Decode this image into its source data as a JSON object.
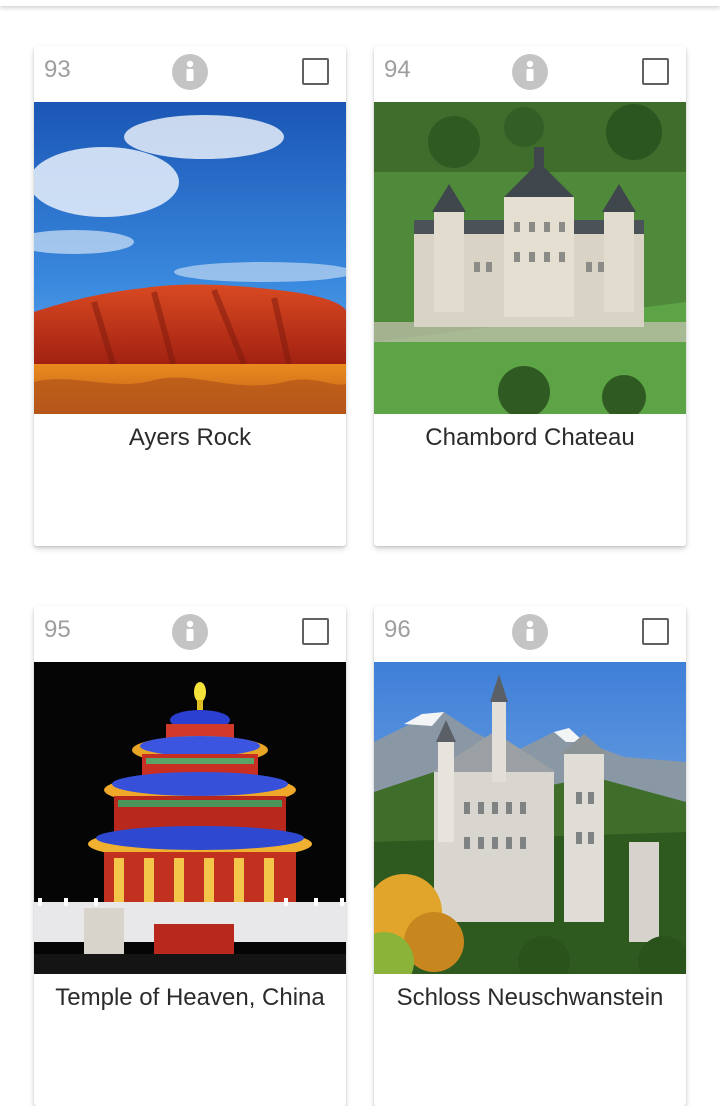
{
  "cards": [
    {
      "number": "93",
      "title": "Ayers Rock",
      "info_icon": "info-icon",
      "checked": false
    },
    {
      "number": "94",
      "title": "Chambord Chateau",
      "info_icon": "info-icon",
      "checked": false
    },
    {
      "number": "95",
      "title": "Temple of Heaven, China",
      "info_icon": "info-icon",
      "checked": false
    },
    {
      "number": "96",
      "title": "Schloss Neuschwanstein",
      "info_icon": "info-icon",
      "checked": false
    }
  ],
  "colors": {
    "number_text": "#9e9e9e",
    "info_icon_bg": "#c4c4c4",
    "title_text": "#2b2b2b",
    "checkbox_border": "#616161"
  }
}
